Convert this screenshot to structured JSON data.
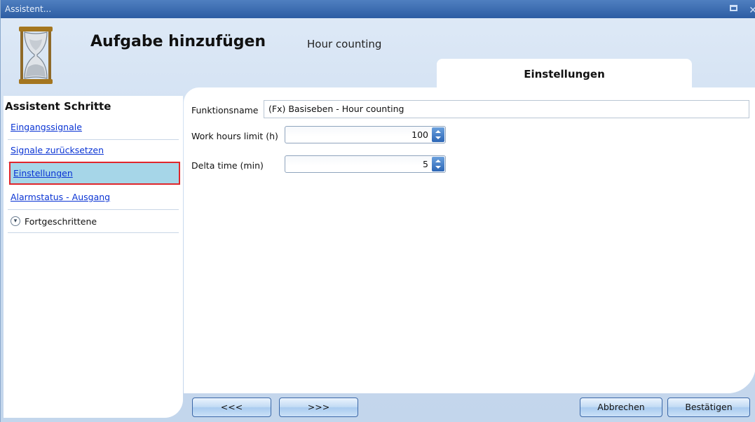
{
  "window": {
    "title": "Assistent..."
  },
  "header": {
    "title": "Aufgabe hinzufügen",
    "subtitle": "Hour counting",
    "icon": "hourglass-icon"
  },
  "tab": {
    "label": "Einstellungen"
  },
  "sidebar": {
    "title": "Assistent Schritte",
    "items": [
      {
        "label": "Eingangssignale"
      },
      {
        "label": "Signale zurücksetzen"
      },
      {
        "label": "Einstellungen",
        "selected": true
      },
      {
        "label": "Alarmstatus - Ausgang"
      }
    ],
    "advanced": {
      "label": "Fortgeschrittene"
    }
  },
  "form": {
    "function_name": {
      "label": "Funktionsname",
      "value": "(Fx) Basiseben - Hour counting"
    },
    "work_hours": {
      "label": "Work hours limit (h)",
      "value": "100"
    },
    "delta_time": {
      "label": "Delta time (min)",
      "value": "5"
    }
  },
  "buttons": {
    "back": "<<<",
    "next": ">>>",
    "cancel": "Abbrechen",
    "confirm": "Bestätigen"
  },
  "colors": {
    "titlebar": "#2d5da3",
    "selection": "#a6d6e8",
    "selection_border": "#e0262b",
    "link": "#0a34d4"
  }
}
